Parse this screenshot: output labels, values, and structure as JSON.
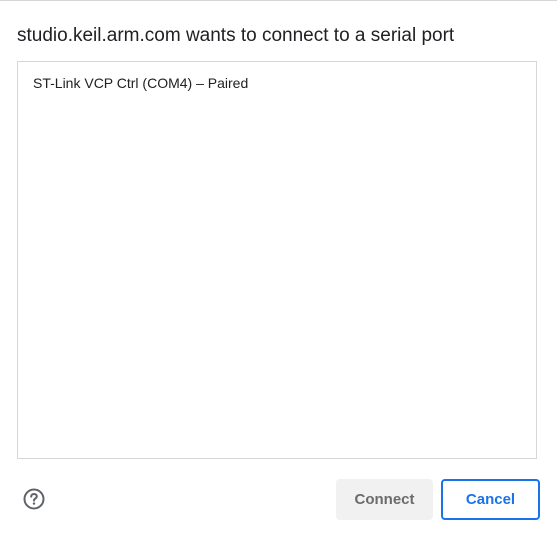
{
  "dialog": {
    "title": "studio.keil.arm.com wants to connect to a serial port",
    "ports": [
      {
        "label": "ST-Link VCP Ctrl (COM4) – Paired"
      }
    ],
    "help_icon": "question-circle-icon",
    "connect_label": "Connect",
    "cancel_label": "Cancel"
  },
  "colors": {
    "accent": "#1a73e8",
    "disabled_button_bg": "#f1f1f1",
    "disabled_button_text": "#6b6b6b",
    "border": "#d6d6d6",
    "text": "#202124"
  }
}
